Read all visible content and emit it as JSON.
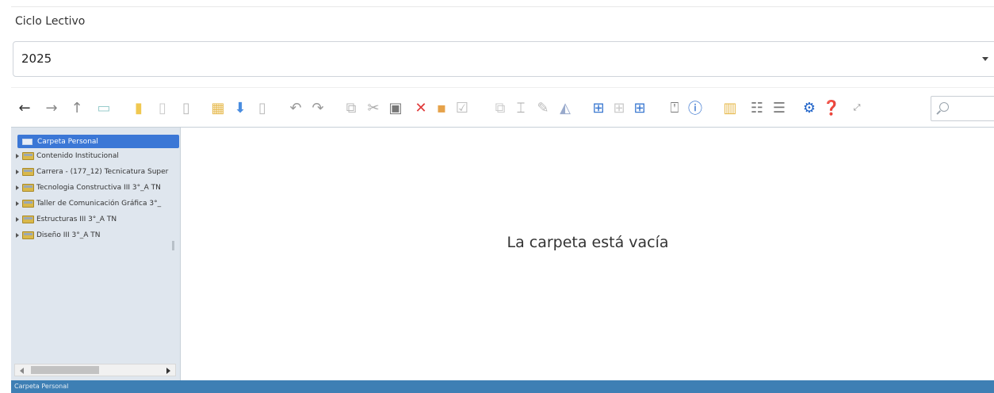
{
  "filter": {
    "label": "Ciclo Lectivo",
    "value": "2025"
  },
  "toolbar": {
    "search_placeholder": ""
  },
  "tree": {
    "items": [
      {
        "label": "Carpeta Personal",
        "selected": true
      },
      {
        "label": "Contenido Institucional"
      },
      {
        "label": "Carrera - (177_12) Tecnicatura Super"
      },
      {
        "label": "Tecnologia Constructiva III 3°_A TN"
      },
      {
        "label": "Taller de Comunicación Gráfica 3°_"
      },
      {
        "label": "Estructuras III 3°_A TN"
      },
      {
        "label": "Diseño III 3°_A TN"
      }
    ]
  },
  "content": {
    "empty_message": "La carpeta está vacía"
  },
  "statusbar": {
    "text": "Carpeta Personal"
  },
  "colors": {
    "accent": "#3b77d6",
    "status": "#3e7fb4",
    "tree_bg": "#dfe6ee"
  }
}
